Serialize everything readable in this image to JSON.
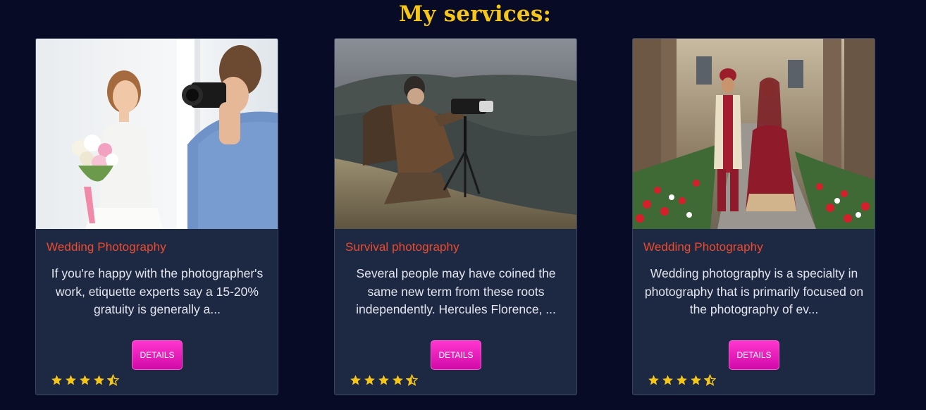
{
  "page": {
    "title": "My services:"
  },
  "colors": {
    "background": "#070b26",
    "title": "#f5c518",
    "card_background": "#1d2943",
    "card_title": "#f04a2c",
    "button": "#e81cba",
    "star": "#f5c518"
  },
  "services": [
    {
      "title": "Wedding Photography",
      "description": "If you're happy with the photographer's work, etiquette experts say a 15-20% gratuity is generally a...",
      "button_label": "DETAILS",
      "rating": 4.5,
      "image": "photographer-shooting-bride-photo"
    },
    {
      "title": "Survival photography",
      "description": "Several people may have coined the same new term from these roots independently. Hercules Florence, ...",
      "button_label": "DETAILS",
      "rating": 4.5,
      "image": "photographer-on-mountain-photo"
    },
    {
      "title": "Wedding Photography",
      "description": "Wedding photography is a specialty in photography that is primarily focused on the photography of ev...",
      "button_label": "DETAILS",
      "rating": 4.5,
      "image": "wedding-couple-walking-photo"
    }
  ]
}
